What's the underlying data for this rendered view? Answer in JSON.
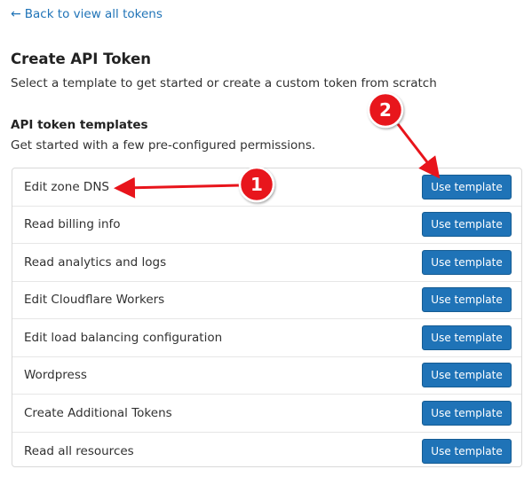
{
  "back_link": {
    "arrow": "←",
    "label": "Back to view all tokens"
  },
  "page": {
    "title": "Create API Token",
    "subtitle": "Select a template to get started or create a custom token from scratch"
  },
  "templates_section": {
    "title": "API token templates",
    "subtitle": "Get started with a few pre-configured permissions.",
    "button_label": "Use template",
    "items": [
      {
        "name": "Edit zone DNS",
        "button": "Use template"
      },
      {
        "name": "Read billing info",
        "button": "Use template"
      },
      {
        "name": "Read analytics and logs",
        "button": "Use template"
      },
      {
        "name": "Edit Cloudflare Workers",
        "button": "Use template"
      },
      {
        "name": "Edit load balancing configuration",
        "button": "Use template"
      },
      {
        "name": "Wordpress",
        "button": "Use template"
      },
      {
        "name": "Create Additional Tokens",
        "button": "Use template"
      },
      {
        "name": "Read all resources",
        "button": "Use template"
      }
    ]
  },
  "annotations": {
    "markers": [
      {
        "label": "1"
      },
      {
        "label": "2"
      }
    ],
    "color": "#e8141b"
  },
  "colors": {
    "link": "#1f73b7",
    "button": "#1f73b7",
    "border": "#d9d9d9"
  }
}
